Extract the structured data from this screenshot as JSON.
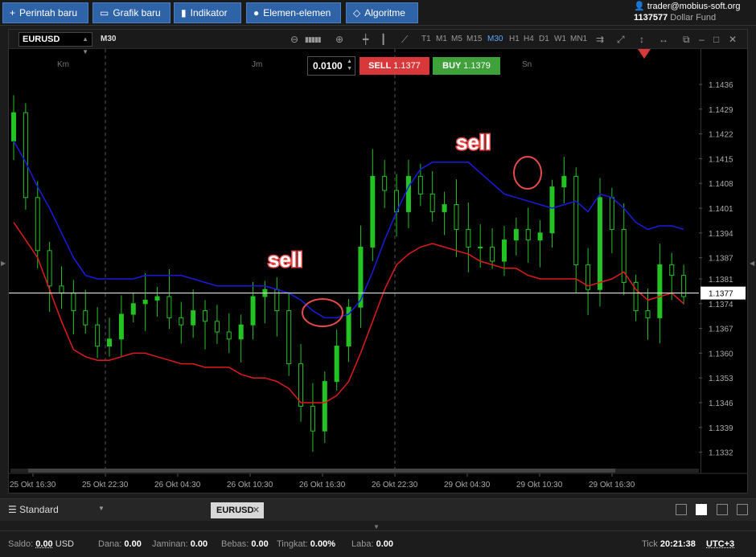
{
  "toolbar": {
    "new_order": "Perintah baru",
    "new_chart": "Grafik baru",
    "indicator": "Indikator",
    "elements": "Elemen-elemen",
    "algorithm": "Algoritme"
  },
  "account": {
    "user": "trader@mobius-soft.org",
    "balance": "1137577",
    "fund": "Dollar Fund"
  },
  "chart": {
    "symbol": "EURUSD",
    "timeframe": "M30",
    "timeframes": [
      "T1",
      "M1",
      "M5",
      "M15",
      "M30",
      "H1",
      "H4",
      "D1",
      "W1",
      "MN1"
    ],
    "active_timeframe": "M30",
    "lot": "0.0100",
    "sell_label": "SELL",
    "sell_price": "1.1377",
    "buy_label": "BUY",
    "buy_price": "1.1379",
    "day_labels": [
      "Km",
      "Jm",
      "Sn"
    ],
    "annotation": "sell",
    "current_price": "1.1377",
    "colors": {
      "up_candle": "#22c322",
      "sma": "#1b1be0",
      "lower": "#e01b1b",
      "sell": "#d9383a",
      "buy": "#3fa13a"
    }
  },
  "chart_data": {
    "type": "candlestick",
    "price_ticks": [
      "1.1436",
      "1.1429",
      "1.1422",
      "1.1415",
      "1.1408",
      "1.1401",
      "1.1394",
      "1.1387",
      "1.1381",
      "1.1374",
      "1.1367",
      "1.1360",
      "1.1353",
      "1.1346",
      "1.1339",
      "1.1332"
    ],
    "time_ticks": [
      "25 Okt 16:30",
      "25 Okt 22:30",
      "26 Okt 04:30",
      "26 Okt 10:30",
      "26 Okt 16:30",
      "26 Okt 22:30",
      "29 Okt 04:30",
      "29 Okt 10:30",
      "29 Okt 16:30"
    ],
    "ylim": [
      1.1326,
      1.1446
    ],
    "current_price": 1.1377,
    "close": [
      1.1428,
      1.1404,
      1.1389,
      1.1379,
      1.1377,
      1.1372,
      1.1368,
      1.1362,
      1.1364,
      1.1371,
      1.1374,
      1.1375,
      1.1376,
      1.137,
      1.1368,
      1.1372,
      1.1369,
      1.1366,
      1.1364,
      1.1368,
      1.1376,
      1.1378,
      1.1372,
      1.1357,
      1.1345,
      1.1338,
      1.1352,
      1.1362,
      1.1373,
      1.139,
      1.141,
      1.1406,
      1.14,
      1.141,
      1.1405,
      1.14,
      1.1402,
      1.1395,
      1.139,
      1.139,
      1.1386,
      1.1392,
      1.1395,
      1.1392,
      1.1394,
      1.1407,
      1.141,
      1.1385,
      1.1378,
      1.1404,
      1.1395,
      1.138,
      1.1372,
      1.137,
      1.1385,
      1.1382,
      1.1376
    ],
    "upper_band": [
      1.142,
      1.1414,
      1.1407,
      1.1401,
      1.1394,
      1.1387,
      1.1382,
      1.1381,
      1.1381,
      1.1381,
      1.1381,
      1.1382,
      1.1382,
      1.1382,
      1.1382,
      1.1381,
      1.138,
      1.1379,
      1.1379,
      1.1379,
      1.1379,
      1.1379,
      1.1378,
      1.1377,
      1.1375,
      1.1372,
      1.137,
      1.137,
      1.1371,
      1.1375,
      1.1383,
      1.1392,
      1.14,
      1.1407,
      1.1412,
      1.1414,
      1.1414,
      1.1414,
      1.1414,
      1.1411,
      1.1408,
      1.1405,
      1.1404,
      1.1403,
      1.1402,
      1.1401,
      1.1402,
      1.1403,
      1.14,
      1.1405,
      1.1404,
      1.1401,
      1.1397,
      1.1395,
      1.1396,
      1.1396,
      1.1395
    ],
    "lower_band": [
      1.1397,
      1.1392,
      1.1387,
      1.1378,
      1.1369,
      1.1361,
      1.1359,
      1.1358,
      1.1358,
      1.1359,
      1.136,
      1.136,
      1.1359,
      1.1358,
      1.1357,
      1.1357,
      1.1356,
      1.1356,
      1.1356,
      1.1354,
      1.1353,
      1.1353,
      1.1352,
      1.135,
      1.1346,
      1.1346,
      1.1346,
      1.1348,
      1.1352,
      1.136,
      1.1369,
      1.1378,
      1.1385,
      1.1388,
      1.139,
      1.1391,
      1.139,
      1.1389,
      1.1388,
      1.1386,
      1.1385,
      1.1384,
      1.1384,
      1.1382,
      1.1381,
      1.1381,
      1.1381,
      1.1381,
      1.1379,
      1.138,
      1.1381,
      1.1383,
      1.1378,
      1.1375,
      1.1376,
      1.1377,
      1.1374
    ]
  },
  "bottom": {
    "layout": "Standard",
    "tab": "EURUSD"
  },
  "status": {
    "saldo_label": "Saldo:",
    "saldo_value": "0.00",
    "saldo_ccy": "USD",
    "dana_label": "Dana:",
    "dana_value": "0.00",
    "jaminan_label": "Jaminan:",
    "jaminan_value": "0.00",
    "bebas_label": "Bebas:",
    "bebas_value": "0.00",
    "tingkat_label": "Tingkat:",
    "tingkat_value": "0.00%",
    "laba_label": "Laba:",
    "laba_value": "0.00",
    "tick_label": "Tick",
    "tick_time": "20:21:38",
    "timezone": "UTC+3"
  }
}
